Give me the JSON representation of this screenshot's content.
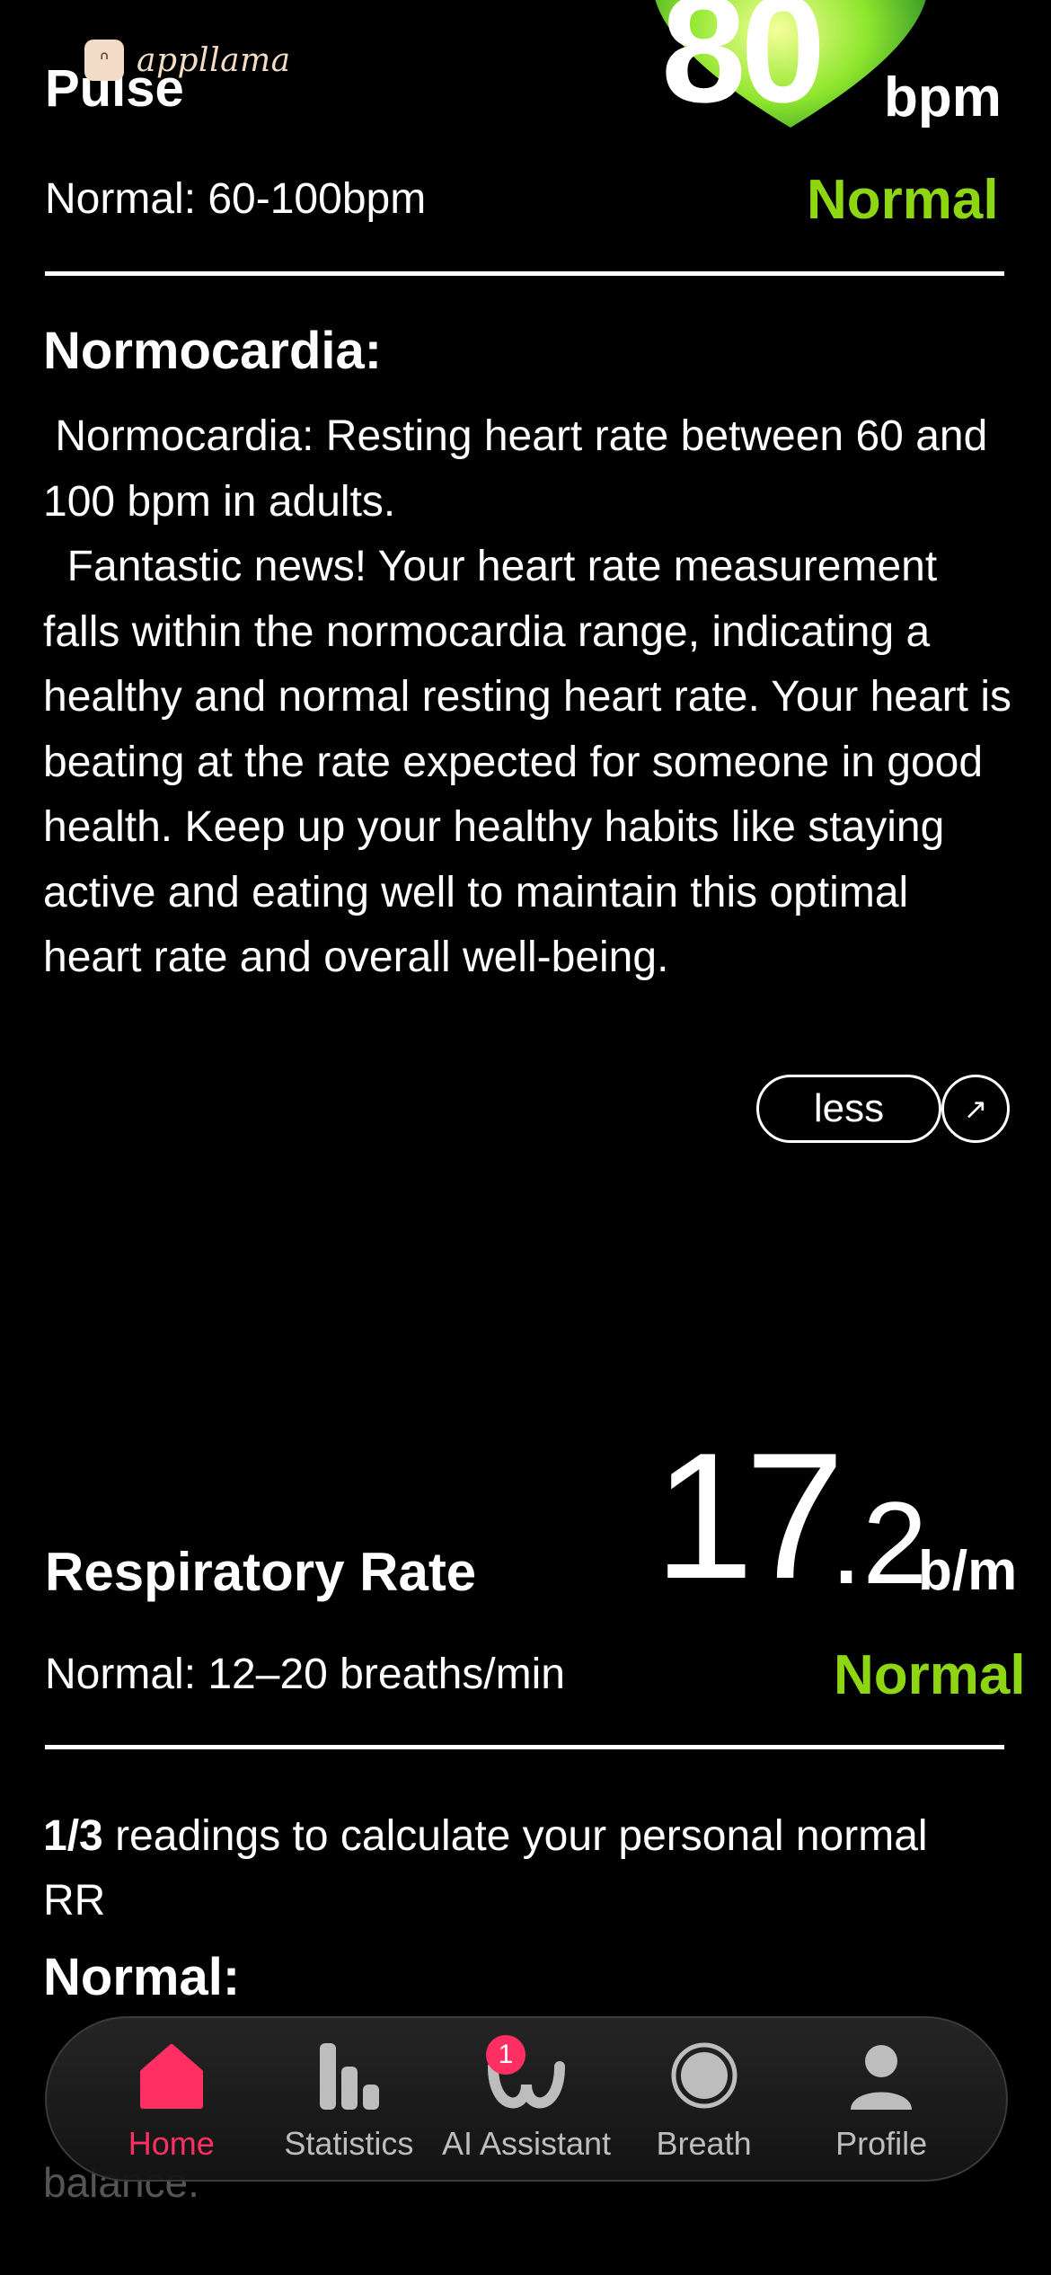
{
  "brand": {
    "name": "appllama"
  },
  "pulse": {
    "title": "Pulse",
    "value": "80",
    "unit": "bpm",
    "range": "Normal: 60-100bpm",
    "status": "Normal",
    "status_color": "#8dd611"
  },
  "normocardia": {
    "heading": "Normocardia:",
    "paragraph1": " Normocardia: Resting heart rate between 60 and 100 bpm in adults.",
    "paragraph2": "  Fantastic news! Your heart rate measurement falls within the normocardia range, indicating a healthy and normal resting heart rate. Your heart is beating at the rate expected for someone in good health. Keep up your healthy habits like staying active and eating well to maintain this optimal heart rate and overall well-being.",
    "less_label": "less",
    "arrow_icon": "arrow-up-right-icon"
  },
  "respiratory": {
    "title": "Respiratory Rate",
    "value_int": "17",
    "value_dec": ".2",
    "unit": "b/m",
    "range": "Normal: 12–20 breaths/min",
    "status": "Normal"
  },
  "readings": {
    "count": "1/3",
    "text": " readings to calculate your personal normal RR"
  },
  "normal_heading": "Normal:",
  "trailing_text": "balance.",
  "tabbar": {
    "accent_color": "#ff2e63",
    "tabs": [
      {
        "label": "Home",
        "icon": "home-icon",
        "active": true
      },
      {
        "label": "Statistics",
        "icon": "bar-chart-icon",
        "active": false
      },
      {
        "label": "AI Assistant",
        "icon": "assistant-icon",
        "active": false,
        "badge": "1"
      },
      {
        "label": "Breath",
        "icon": "breath-circle-icon",
        "active": false
      },
      {
        "label": "Profile",
        "icon": "person-icon",
        "active": false
      }
    ]
  }
}
